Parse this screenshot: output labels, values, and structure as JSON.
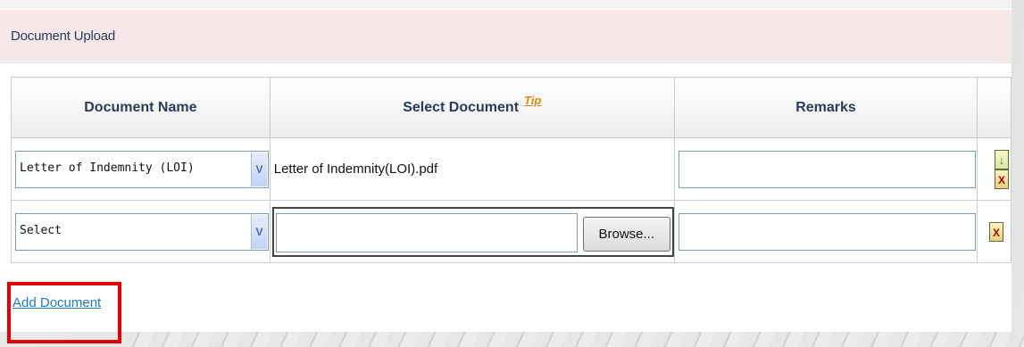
{
  "section": {
    "title": "Document Upload"
  },
  "table": {
    "headers": [
      "Document Name",
      "Select Document",
      "Remarks"
    ],
    "tip_label": "Tip",
    "rows": [
      {
        "document_name": "Letter of Indemnity (LOI)",
        "selected_document": "Letter of Indemnity(LOI).pdf",
        "remarks": ""
      },
      {
        "document_name": "Select",
        "file_value": "",
        "browse_label": "Browse...",
        "remarks": ""
      }
    ]
  },
  "actions": {
    "add_document_label": "Add Document"
  },
  "icons": {
    "download": "download-icon",
    "delete": "delete-icon",
    "dropdown": "chevron-down-icon"
  },
  "colors": {
    "header_bg": "#f6e8e8",
    "link": "#1a7ac9",
    "highlight": "#e20000",
    "tip": "#d9900a"
  }
}
